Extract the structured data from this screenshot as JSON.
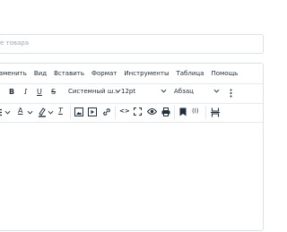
{
  "product_name": {
    "placeholder": "е товара"
  },
  "menubar": {
    "items": [
      "Изменить",
      "Вид",
      "Вставить",
      "Формат",
      "Инструменты",
      "Таблица",
      "Помощь"
    ]
  },
  "toolbar": {
    "bold": "B",
    "italic": "I",
    "underline": "U",
    "strikethrough": "S",
    "font_family": "Системный ш...",
    "font_size": "12pt",
    "block_format": "Абзац",
    "text_color": "A",
    "clear_format": "T",
    "code": "<>",
    "rtl": "(I)"
  },
  "colors": {
    "text_color_indicator": "#222f3e",
    "icon": "#222f3e",
    "border": "#dde1e6"
  },
  "icons": [
    "bullet-list-icon",
    "text-color-icon",
    "highlight-icon",
    "clear-format-icon",
    "image-icon",
    "media-icon",
    "link-icon",
    "code-icon",
    "fullscreen-icon",
    "preview-icon",
    "print-icon",
    "bookmark-icon",
    "page-break-icon",
    "more-icon"
  ]
}
